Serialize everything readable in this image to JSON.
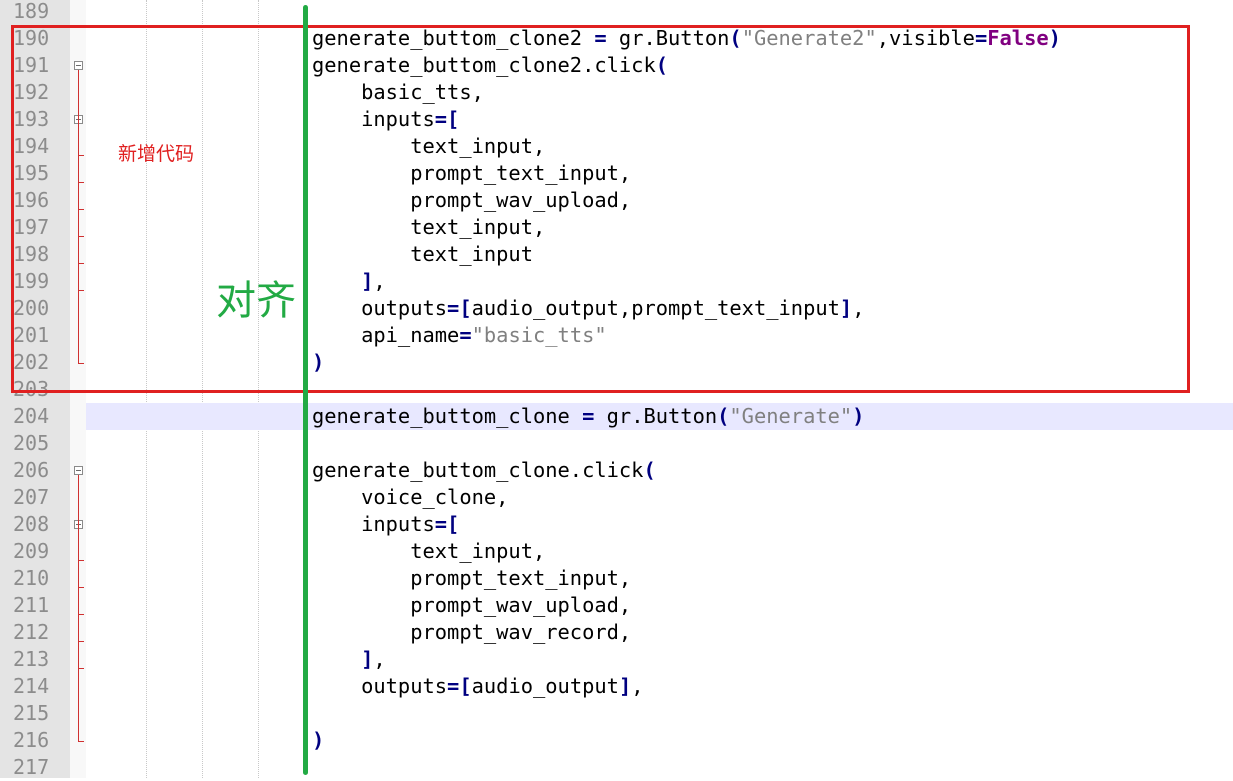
{
  "annotations": {
    "new_code_label": "新增代码",
    "align_label": "对齐",
    "box_color": "#e02020",
    "line_color": "#22aa44"
  },
  "lines": [
    {
      "no": "189",
      "segs": []
    },
    {
      "no": "190",
      "segs": [
        [
          "generate_buttom_clone2 ",
          ""
        ],
        [
          "=",
          "op"
        ],
        [
          " gr.Button",
          ""
        ],
        [
          "(",
          "op"
        ],
        [
          "\"Generate2\"",
          "str"
        ],
        [
          ",visible",
          ""
        ],
        [
          "=",
          "op"
        ],
        [
          "False",
          "kw"
        ],
        [
          ")",
          "op"
        ]
      ]
    },
    {
      "no": "191",
      "segs": [
        [
          "generate_buttom_clone2.click",
          ""
        ],
        [
          "(",
          "op"
        ]
      ]
    },
    {
      "no": "192",
      "segs": [
        [
          "    basic_tts,",
          ""
        ]
      ]
    },
    {
      "no": "193",
      "segs": [
        [
          "    inputs",
          ""
        ],
        [
          "=[",
          "op"
        ]
      ]
    },
    {
      "no": "194",
      "segs": [
        [
          "        text_input,",
          ""
        ]
      ]
    },
    {
      "no": "195",
      "segs": [
        [
          "        prompt_text_input,",
          ""
        ]
      ]
    },
    {
      "no": "196",
      "segs": [
        [
          "        prompt_wav_upload,",
          ""
        ]
      ]
    },
    {
      "no": "197",
      "segs": [
        [
          "        text_input,",
          ""
        ]
      ]
    },
    {
      "no": "198",
      "segs": [
        [
          "        text_input",
          ""
        ]
      ]
    },
    {
      "no": "199",
      "segs": [
        [
          "    ",
          ""
        ],
        [
          "]",
          "op"
        ],
        [
          ",",
          ""
        ]
      ]
    },
    {
      "no": "200",
      "segs": [
        [
          "    outputs",
          ""
        ],
        [
          "=[",
          "op"
        ],
        [
          "audio_output,prompt_text_input",
          ""
        ],
        [
          "]",
          "op"
        ],
        [
          ",",
          ""
        ]
      ]
    },
    {
      "no": "201",
      "segs": [
        [
          "    api_name",
          ""
        ],
        [
          "=",
          "op"
        ],
        [
          "\"basic_tts\"",
          "str"
        ]
      ]
    },
    {
      "no": "202",
      "segs": [
        [
          ")",
          "op"
        ]
      ]
    },
    {
      "no": "203",
      "segs": []
    },
    {
      "no": "204",
      "segs": [
        [
          "generate_buttom_clone ",
          ""
        ],
        [
          "=",
          "op"
        ],
        [
          " gr.Button",
          ""
        ],
        [
          "(",
          "op"
        ],
        [
          "\"Generate\"",
          "str"
        ],
        [
          ")",
          "op"
        ]
      ]
    },
    {
      "no": "205",
      "segs": []
    },
    {
      "no": "206",
      "segs": [
        [
          "generate_buttom_clone.click",
          ""
        ],
        [
          "(",
          "op"
        ]
      ]
    },
    {
      "no": "207",
      "segs": [
        [
          "    voice_clone,",
          ""
        ]
      ]
    },
    {
      "no": "208",
      "segs": [
        [
          "    inputs",
          ""
        ],
        [
          "=[",
          "op"
        ]
      ]
    },
    {
      "no": "209",
      "segs": [
        [
          "        text_input,",
          ""
        ]
      ]
    },
    {
      "no": "210",
      "segs": [
        [
          "        prompt_text_input,",
          ""
        ]
      ]
    },
    {
      "no": "211",
      "segs": [
        [
          "        prompt_wav_upload,",
          ""
        ]
      ]
    },
    {
      "no": "212",
      "segs": [
        [
          "        prompt_wav_record,",
          ""
        ]
      ]
    },
    {
      "no": "213",
      "segs": [
        [
          "    ",
          ""
        ],
        [
          "]",
          "op"
        ],
        [
          ",",
          ""
        ]
      ]
    },
    {
      "no": "214",
      "segs": [
        [
          "    outputs",
          ""
        ],
        [
          "=[",
          "op"
        ],
        [
          "audio_output",
          ""
        ],
        [
          "]",
          "op"
        ],
        [
          ",",
          ""
        ]
      ]
    },
    {
      "no": "215",
      "segs": []
    },
    {
      "no": "216",
      "segs": [
        [
          ")",
          "op"
        ]
      ]
    },
    {
      "no": "217",
      "segs": []
    }
  ]
}
